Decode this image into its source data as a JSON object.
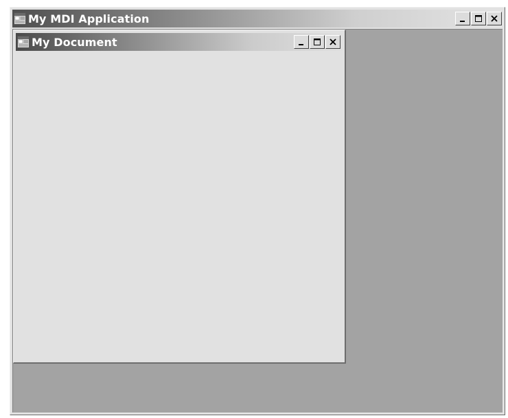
{
  "parent_window": {
    "title": "My MDI Application",
    "icon": "app-window-icon",
    "controls": {
      "minimize": "minimize-icon",
      "maximize": "maximize-icon",
      "close": "close-icon"
    }
  },
  "child_window": {
    "title": "My Document",
    "icon": "document-window-icon",
    "controls": {
      "minimize": "minimize-icon",
      "maximize": "maximize-icon",
      "close": "close-icon"
    }
  },
  "colors": {
    "mdi_background": "#a3a3a3",
    "window_face": "#e1e1e1",
    "titlebar_dark": "#4f4f4f",
    "titlebar_light": "#e3e3e3"
  }
}
